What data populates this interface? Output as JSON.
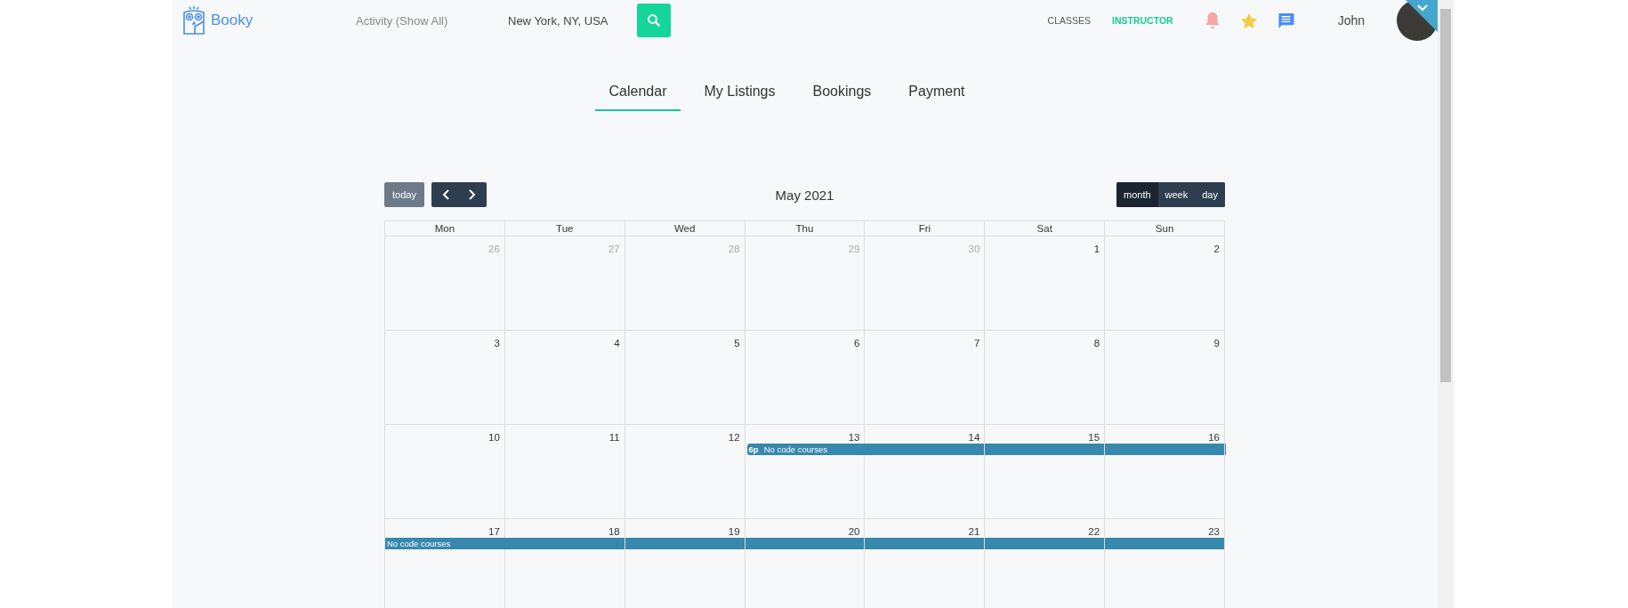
{
  "header": {
    "logo": "Booky",
    "activity": "Activity (Show All)",
    "location": "New York, NY, USA",
    "nav": [
      {
        "label": "CLASSES",
        "selected": false
      },
      {
        "label": "INSTRUCTOR",
        "selected": true
      }
    ],
    "user": "John"
  },
  "tabs": [
    {
      "label": "Calendar",
      "selected": true
    },
    {
      "label": "My Listings",
      "selected": false
    },
    {
      "label": "Bookings",
      "selected": false
    },
    {
      "label": "Payment",
      "selected": false
    }
  ],
  "calendar": {
    "today": "today",
    "title": "May 2021",
    "views": [
      {
        "label": "month",
        "selected": true
      },
      {
        "label": "week",
        "selected": false
      },
      {
        "label": "day",
        "selected": false
      }
    ],
    "weekdays": [
      "Mon",
      "Tue",
      "Wed",
      "Thu",
      "Fri",
      "Sat",
      "Sun"
    ],
    "weeks": [
      {
        "days": [
          {
            "number": "26",
            "other_month": true
          },
          {
            "number": "27",
            "other_month": true
          },
          {
            "number": "28",
            "other_month": true
          },
          {
            "number": "29",
            "other_month": true
          },
          {
            "number": "30",
            "other_month": true
          },
          {
            "number": "1",
            "other_month": false
          },
          {
            "number": "2",
            "other_month": false
          }
        ]
      },
      {
        "days": [
          {
            "number": "3",
            "other_month": false
          },
          {
            "number": "4",
            "other_month": false
          },
          {
            "number": "5",
            "other_month": false
          },
          {
            "number": "6",
            "other_month": false
          },
          {
            "number": "7",
            "other_month": false
          },
          {
            "number": "8",
            "other_month": false
          },
          {
            "number": "9",
            "other_month": false
          }
        ]
      },
      {
        "days": [
          {
            "number": "10",
            "other_month": false
          },
          {
            "number": "11",
            "other_month": false
          },
          {
            "number": "12",
            "other_month": false
          },
          {
            "number": "13",
            "other_month": false,
            "event": {
              "time": "6p",
              "title": "No code courses"
            }
          },
          {
            "number": "14",
            "other_month": false
          },
          {
            "number": "15",
            "other_month": false
          },
          {
            "number": "16",
            "other_month": false
          }
        ]
      },
      {
        "days": [
          {
            "number": "17",
            "other_month": false,
            "event": {
              "title": "No code courses"
            }
          },
          {
            "number": "18",
            "other_month": false
          },
          {
            "number": "19",
            "other_month": false
          },
          {
            "number": "20",
            "other_month": false
          },
          {
            "number": "21",
            "other_month": false
          },
          {
            "number": "22",
            "other_month": false
          },
          {
            "number": "23",
            "other_month": false
          }
        ]
      }
    ]
  }
}
